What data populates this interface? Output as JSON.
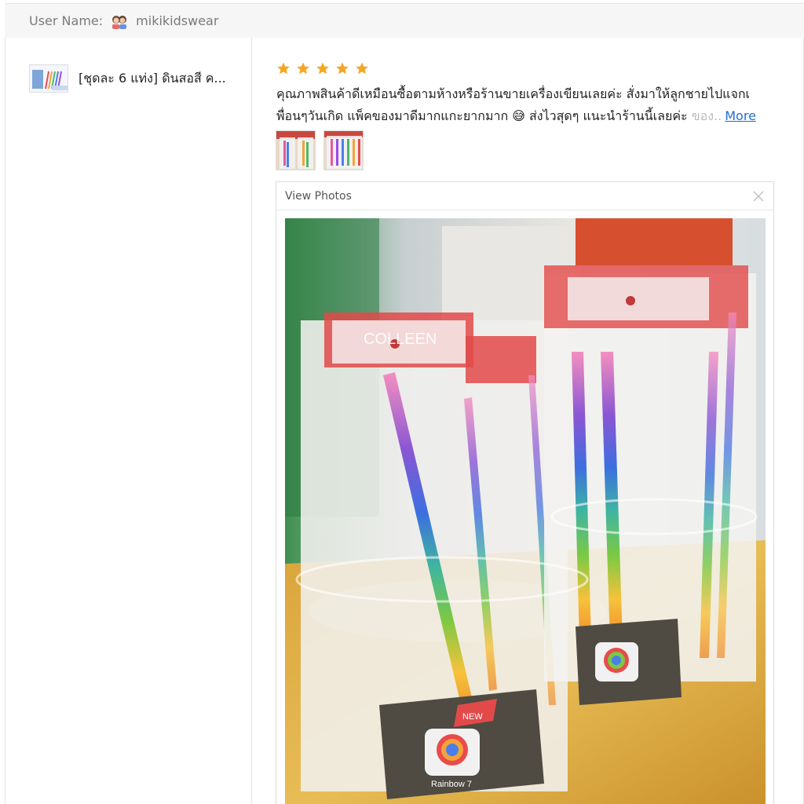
{
  "header": {
    "user_label": "User Name:",
    "username": "mikikidswear"
  },
  "product": {
    "name": "[ชุดละ 6 แท่ง] ดินสอสี ค..."
  },
  "review": {
    "rating": 5,
    "line1": "คุณภาพสินค้าดีเหมือนซื้อตามห้างหรือร้านขายเครื่องเขียนเลยค่ะ สั่งมาให้ลูกชายไปแจกเ",
    "line2": "พื่อนๆวันเกิด แพ็คของมาดีมากแกะยากมาก 😅 ส่งไวสุดๆ แนะนำร้านนี้เลยค่ะ",
    "line2_fade": " ของ..",
    "more_label": "More"
  },
  "viewer": {
    "title": "View Photos"
  },
  "photo": {
    "brand_text": "COLLEEN",
    "badge_text": "NEW",
    "product_label": "Rainbow 7"
  },
  "colors": {
    "star": "#f5a623",
    "link": "#1f6fd1"
  }
}
